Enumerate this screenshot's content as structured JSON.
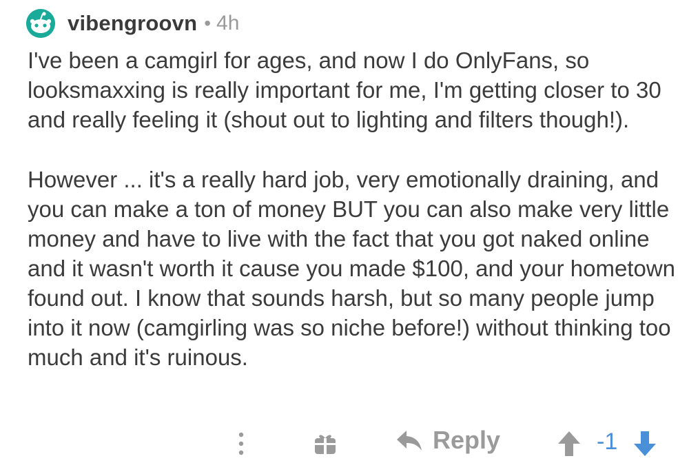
{
  "comment": {
    "username": "vibengroovn",
    "separator": "•",
    "age": "4h",
    "paragraphs": [
      "I've been a camgirl for ages, and now I do OnlyFans, so looksmaxxing is really important for me, I'm getting closer to 30 and really feeling it (shout out to lighting and filters though!).",
      "However ... it's a really hard job, very emotionally draining, and you can make a ton of money BUT you can also make very little money and have to live with the fact that you got naked online and it wasn't worth it cause you made $100, and your hometown found out. I know that sounds harsh, but so many people jump into it now (camgirling was so niche before!) without thinking too much and it's ruinous."
    ]
  },
  "actions": {
    "more_icon": "vertical-ellipsis-icon",
    "gift_icon": "gift-icon",
    "reply_icon": "reply-arrow-icon",
    "reply_label": "Reply",
    "upvote_icon": "upvote-arrow-icon",
    "score": "-1",
    "downvote_icon": "downvote-arrow-icon"
  },
  "colors": {
    "avatar": "#1aaa9a",
    "text": "#3b3b3b",
    "muted": "#9a9a9a",
    "downvoted": "#4a90d9"
  }
}
